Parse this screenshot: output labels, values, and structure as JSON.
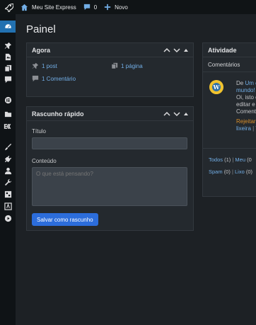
{
  "adminbar": {
    "site_name": "Meu Site Express",
    "comment_count": "0",
    "new_label": "Novo"
  },
  "sidebar": {
    "items": [
      {
        "name": "dashboard",
        "active": true
      },
      {
        "name": "posts"
      },
      {
        "name": "media"
      },
      {
        "name": "pages"
      },
      {
        "name": "comments"
      },
      {
        "name": "elementor"
      },
      {
        "name": "templates"
      },
      {
        "name": "elementskit"
      },
      {
        "name": "appearance"
      },
      {
        "name": "plugins"
      },
      {
        "name": "users"
      },
      {
        "name": "tools"
      },
      {
        "name": "settings"
      },
      {
        "name": "extra-plugin"
      },
      {
        "name": "media-player"
      }
    ]
  },
  "page": {
    "title": "Painel"
  },
  "glance": {
    "title": "Agora",
    "posts": "1 post",
    "pages": "1 página",
    "comments": "1 Comentário"
  },
  "quick_draft": {
    "title": "Rascunho rápido",
    "title_label": "Título",
    "title_value": "",
    "content_label": "Conteúdo",
    "content_placeholder": "O que está pensando?",
    "save_button": "Salvar como rascunho"
  },
  "activity": {
    "title": "Atividade",
    "comments_heading": "Comentários",
    "comment": {
      "prefix": "De",
      "author_link": "Um c",
      "post_link": "mundo!",
      "line1": "Oi, isto é",
      "line2": "editar e",
      "line3": "Coment",
      "reject": "Rejeitar",
      "trash": "lixeira",
      "more": "V"
    },
    "filters": {
      "all_label": "Todos",
      "all_count": "(1)",
      "mine_label": "Meu",
      "mine_count": "(0",
      "spam_label": "Spam",
      "spam_count": "(0)",
      "trash_label": "Lixo",
      "trash_count": "(0)"
    }
  },
  "colors": {
    "accent": "#2271b1",
    "link": "#72aee6",
    "button": "#2c6ddb",
    "warning": "#d88e2a"
  }
}
